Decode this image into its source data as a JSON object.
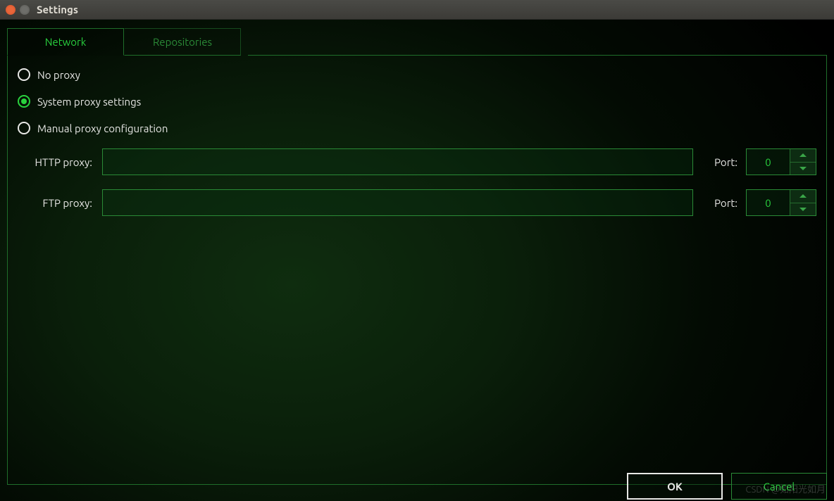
{
  "window": {
    "title": "Settings"
  },
  "tabs": {
    "network": "Network",
    "repositories": "Repositories",
    "active": "network"
  },
  "proxy": {
    "options": {
      "none": "No proxy",
      "system": "System proxy settings",
      "manual": "Manual proxy configuration"
    },
    "selected": "system",
    "http_label": "HTTP proxy:",
    "ftp_label": "FTP proxy:",
    "port_label": "Port:",
    "http_value": "",
    "ftp_value": "",
    "http_port": "0",
    "ftp_port": "0"
  },
  "buttons": {
    "ok": "OK",
    "cancel": "Cancel"
  },
  "watermark": "CSDN @如阳光如月"
}
